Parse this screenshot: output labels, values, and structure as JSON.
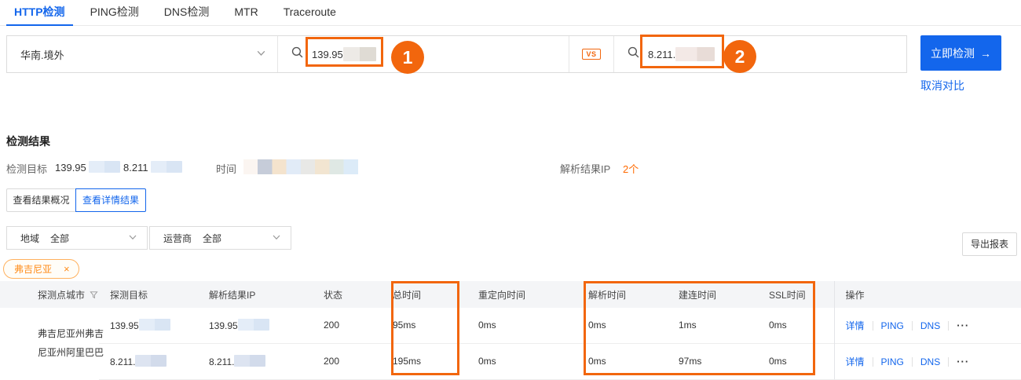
{
  "colors": {
    "accent_blue": "#1366ec",
    "annotation_orange": "#f2660d",
    "tag_orange": "#ff8c1a",
    "count_orange": "#ff6a00",
    "table_header_bg": "#f4f5f7"
  },
  "tabs": {
    "items": [
      {
        "label": "HTTP检测"
      },
      {
        "label": "PING检测"
      },
      {
        "label": "DNS检测"
      },
      {
        "label": "MTR"
      },
      {
        "label": "Traceroute"
      }
    ],
    "active": "HTTP检测"
  },
  "query": {
    "region": {
      "value": "华南.境外"
    },
    "target1": {
      "visible_value": "139.95"
    },
    "vs_badge": "VS",
    "target2": {
      "visible_value": "8.211."
    },
    "submit": {
      "label": "立即检测",
      "arrow": "→"
    },
    "cancel_compare": "取消对比",
    "annotation_1": "1",
    "annotation_2": "2"
  },
  "results": {
    "title": "检测结果",
    "target_label": "检测目标",
    "target_value_a": "139.95",
    "target_value_b": "8.211",
    "time_label": "时间",
    "resolved_label": "解析结果IP",
    "resolved_value": "2个",
    "btn_overview": "查看结果概况",
    "btn_detail": "查看详情结果",
    "filter_region_label": "地域",
    "filter_region_value": "全部",
    "filter_isp_label": "运营商",
    "filter_isp_value": "全部",
    "export_label": "导出报表",
    "tag_label": "弗吉尼亚",
    "tag_close": "×"
  },
  "table": {
    "headers": [
      "探测点城市",
      "探测目标",
      "解析结果IP",
      "状态",
      "总时间",
      "重定向时间",
      "解析时间",
      "建连时间",
      "SSL时间",
      "操作"
    ],
    "city": "弗吉尼亚州弗吉尼亚州阿里巴巴",
    "rows": [
      {
        "target": "139.95",
        "resolved_ip": "139.95",
        "status": "200",
        "total_time": "95ms",
        "redirect_time": "0ms",
        "dns_time": "0ms",
        "connect_time": "1ms",
        "ssl_time": "0ms"
      },
      {
        "target": "8.211.",
        "resolved_ip": "8.211.",
        "status": "200",
        "total_time": "195ms",
        "redirect_time": "0ms",
        "dns_time": "0ms",
        "connect_time": "97ms",
        "ssl_time": "0ms"
      }
    ],
    "actions": {
      "detail": "详情",
      "ping": "PING",
      "dns": "DNS",
      "more": "···"
    }
  }
}
